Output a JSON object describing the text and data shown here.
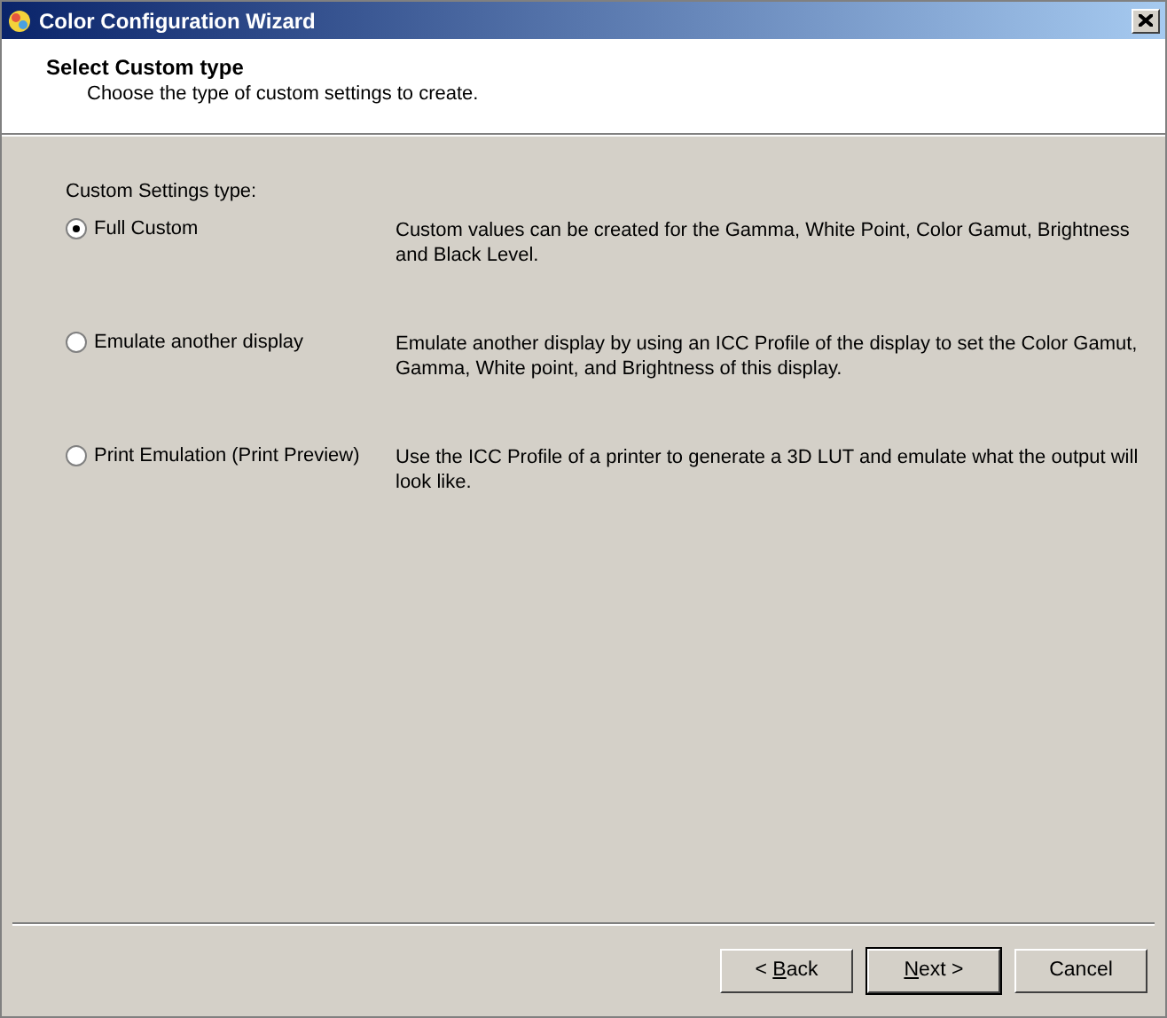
{
  "window": {
    "title": "Color Configuration Wizard"
  },
  "header": {
    "title": "Select Custom type",
    "subtitle": "Choose the type of custom settings to create."
  },
  "group_label": "Custom Settings type:",
  "options": [
    {
      "label": "Full Custom",
      "selected": true,
      "description": "Custom values can be created for the Gamma, White Point, Color Gamut, Brightness and Black Level."
    },
    {
      "label": "Emulate another display",
      "selected": false,
      "description": "Emulate another display by using an ICC Profile of the display to set the Color Gamut, Gamma, White point, and Brightness of this display."
    },
    {
      "label": "Print Emulation (Print Preview)",
      "selected": false,
      "description": "Use the ICC Profile of a printer to generate a 3D LUT and emulate what the output will look like."
    }
  ],
  "buttons": [
    {
      "before": "< ",
      "key": "B",
      "after": "ack",
      "default": false
    },
    {
      "key": "N",
      "after": "ext >",
      "default": true
    },
    {
      "before": "Cancel",
      "default": false
    }
  ]
}
